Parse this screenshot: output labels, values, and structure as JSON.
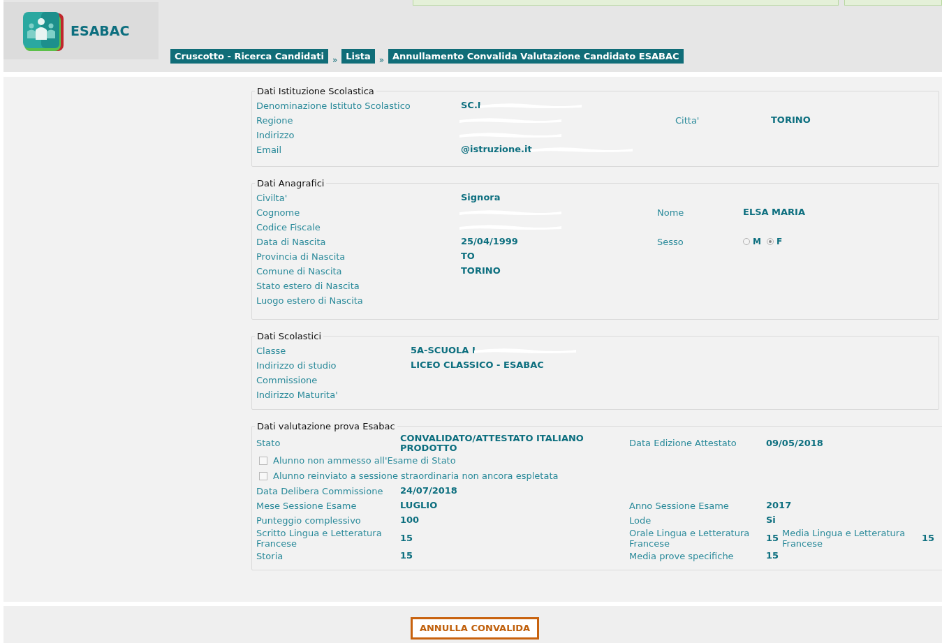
{
  "header": {
    "app_name": "ESABAC"
  },
  "breadcrumbs": [
    {
      "label": "Cruscotto - Ricerca Candidati",
      "separator": "»"
    },
    {
      "label": "Lista",
      "separator": "»"
    },
    {
      "label": "Annullamento Convalida Valutazione Candidato ESABAC"
    }
  ],
  "sections": [
    {
      "title": "Dati Istituzione Scolastica",
      "rows": [
        {
          "kind": "fields",
          "cells": [
            {
              "label": "Denominazione Istituto Scolastico",
              "value": "SC.I",
              "redacted": true
            }
          ]
        },
        {
          "kind": "fields",
          "cells": [
            {
              "label": "Regione",
              "redacted": true
            },
            {
              "label": "Citta'",
              "value": "TORINO"
            }
          ]
        },
        {
          "kind": "fields",
          "cells": [
            {
              "label": "Indirizzo",
              "redacted": true
            }
          ]
        },
        {
          "kind": "fields",
          "cells": [
            {
              "label": "Email",
              "value": "@istruzione.it",
              "redacted": true
            }
          ]
        }
      ]
    },
    {
      "title": "Dati Anagrafici",
      "rows": [
        {
          "kind": "fields",
          "cells": [
            {
              "label": "Civilta'",
              "value": "Signora"
            }
          ]
        },
        {
          "kind": "fields",
          "cells": [
            {
              "label": "Cognome",
              "redacted": true
            },
            {
              "label": "Nome",
              "value": "ELSA MARIA"
            }
          ]
        },
        {
          "kind": "fields",
          "cells": [
            {
              "label": "Codice Fiscale",
              "redacted": true
            }
          ]
        },
        {
          "kind": "fields",
          "cells": [
            {
              "label": "Data di Nascita",
              "value": "25/04/1999"
            },
            {
              "label": "Sesso",
              "options": [
                {
                  "label": "M",
                  "selected": false
                },
                {
                  "label": "F",
                  "selected": true
                }
              ]
            }
          ]
        },
        {
          "kind": "fields",
          "cells": [
            {
              "label": "Provincia di Nascita",
              "value": "TO"
            }
          ]
        },
        {
          "kind": "fields",
          "cells": [
            {
              "label": "Comune di Nascita",
              "value": "TORINO"
            }
          ]
        },
        {
          "kind": "fields",
          "cells": [
            {
              "label": "Stato estero di Nascita"
            }
          ]
        },
        {
          "kind": "fields",
          "cells": [
            {
              "label": "Luogo estero di Nascita"
            }
          ]
        }
      ]
    },
    {
      "title": "Dati Scolastici",
      "rows": [
        {
          "kind": "fields",
          "cells": [
            {
              "label": "Classe",
              "value": "5A-SCUOLA I",
              "redacted": true
            }
          ]
        },
        {
          "kind": "fields",
          "cells": [
            {
              "label": "Indirizzo di studio",
              "value": "LICEO CLASSICO - ESABAC"
            }
          ]
        },
        {
          "kind": "fields",
          "cells": [
            {
              "label": "Commissione"
            }
          ]
        },
        {
          "kind": "fields",
          "cells": [
            {
              "label": "Indirizzo Maturita'"
            }
          ]
        }
      ]
    },
    {
      "title": "Dati valutazione prova Esabac",
      "rows": [
        {
          "kind": "fields",
          "cells": [
            {
              "label": "Stato",
              "value": "CONVALIDATO/ATTESTATO ITALIANO PRODOTTO"
            },
            {
              "label": "Data Edizione Attestato",
              "value": "09/05/2018"
            }
          ]
        },
        {
          "kind": "checkbox",
          "label": "Alunno non ammesso all'Esame di Stato",
          "checked": false
        },
        {
          "kind": "checkbox",
          "label": "Alunno reinviato a sessione straordinaria non ancora espletata",
          "checked": false
        },
        {
          "kind": "fields",
          "cells": [
            {
              "label": "Data Delibera Commissione",
              "value": "24/07/2018"
            }
          ]
        },
        {
          "kind": "fields",
          "cells": [
            {
              "label": "Mese Sessione Esame",
              "value": "LUGLIO"
            },
            {
              "label": "Anno Sessione Esame",
              "value": "2017"
            }
          ]
        },
        {
          "kind": "fields",
          "cells": [
            {
              "label": "Punteggio complessivo",
              "value": "100"
            },
            {
              "label": "Lode",
              "value": "Si"
            }
          ]
        },
        {
          "kind": "fields",
          "cells": [
            {
              "label": "Scritto Lingua e Letteratura Francese",
              "value": "15"
            },
            {
              "label": "Orale Lingua e Letteratura Francese",
              "value": "15"
            },
            {
              "label": "Media Lingua e Letteratura Francese",
              "value": "15"
            }
          ]
        },
        {
          "kind": "fields",
          "cells": [
            {
              "label": "Storia",
              "value": "15"
            },
            {
              "label": "Media prove specifiche",
              "value": "15"
            }
          ]
        }
      ]
    }
  ],
  "actions": [
    {
      "label": "ANNULLA CONVALIDA"
    }
  ]
}
